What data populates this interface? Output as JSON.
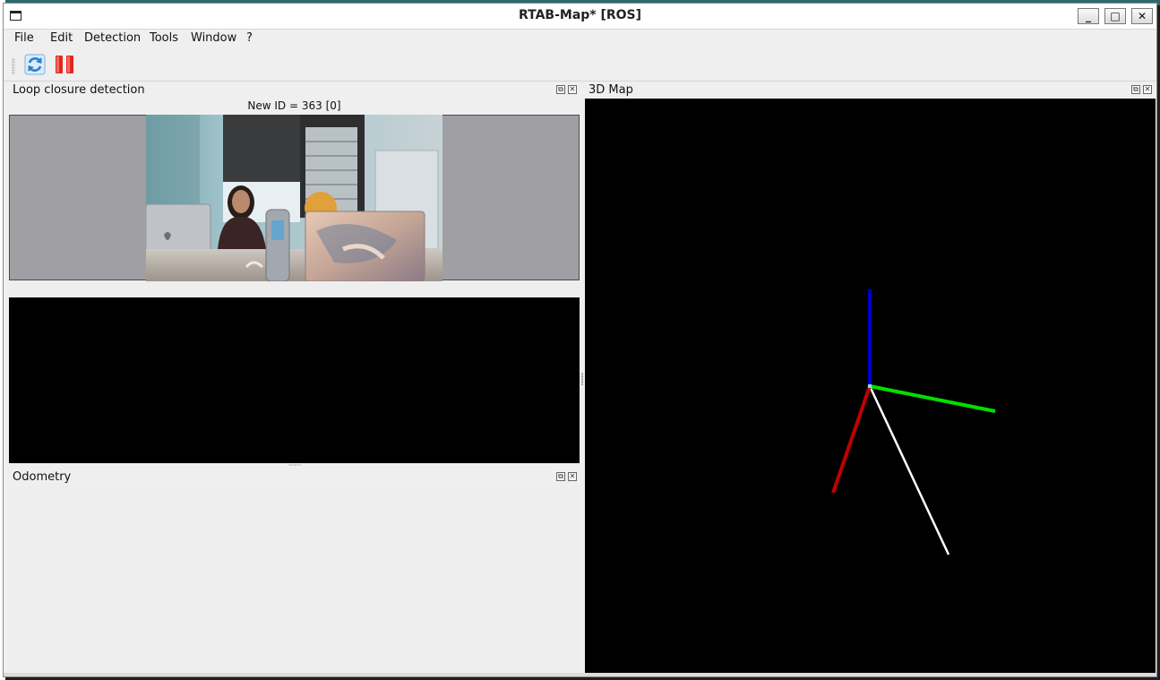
{
  "window": {
    "title": "RTAB-Map* [ROS]"
  },
  "titlebar_buttons": {
    "minimize": "_",
    "maximize": "□",
    "close": "✕"
  },
  "menu": [
    "File",
    "Edit",
    "Detection",
    "Tools",
    "Window",
    "?"
  ],
  "toolbar": {
    "icons": [
      "refresh-icon",
      "pause-icon"
    ]
  },
  "loop_closure": {
    "title": "Loop closure detection",
    "new_id_label": "New ID = 363 [0]"
  },
  "odometry": {
    "title": "Odometry"
  },
  "map3d": {
    "title": "3D Map",
    "axis_colors": {
      "x": "#c00000",
      "y": "#00e000",
      "z": "#0000c8",
      "path": "#ffffff"
    }
  },
  "dock_buttons": {
    "float": "⧉",
    "close": "✕"
  }
}
